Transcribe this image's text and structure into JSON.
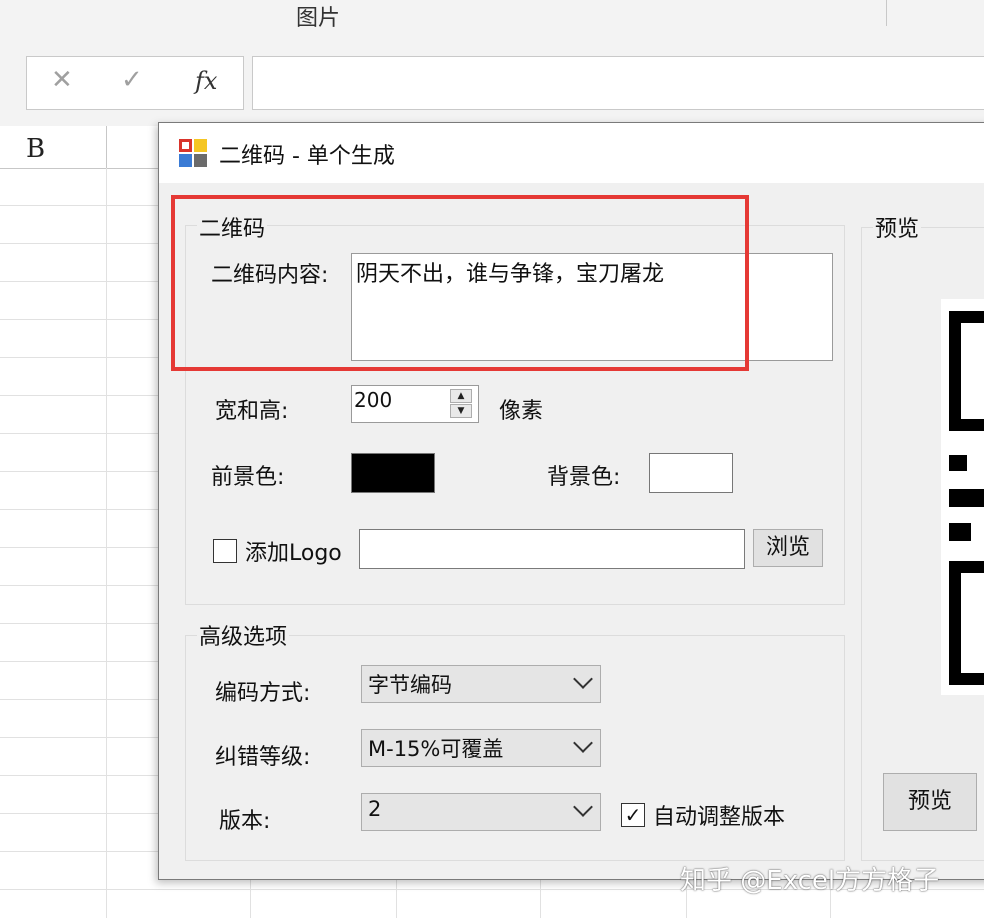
{
  "excel": {
    "ribbon_label": "图片",
    "formula_buttons": {
      "cancel": "✕",
      "enter": "✓",
      "fx": "fx"
    },
    "column_b": "B"
  },
  "dialog": {
    "title": "二维码 - 单个生成",
    "qr_group": {
      "legend": "二维码",
      "content_label": "二维码内容:",
      "content_value": "阴天不出，谁与争锋，宝刀屠龙",
      "size_label": "宽和高:",
      "size_value": "200",
      "size_unit": "像素",
      "fg_label": "前景色:",
      "bg_label": "背景色:",
      "fg_color": "#000000",
      "bg_color": "#ffffff",
      "add_logo_label": "添加Logo",
      "add_logo_checked": false,
      "browse_button": "浏览"
    },
    "advanced_group": {
      "legend": "高级选项",
      "encoding_label": "编码方式:",
      "encoding_value": "字节编码",
      "ecc_label": "纠错等级:",
      "ecc_value": "M-15%可覆盖",
      "version_label": "版本:",
      "version_value": "2",
      "auto_version_label": "自动调整版本",
      "auto_version_checked": true
    },
    "preview_group": {
      "legend": "预览",
      "preview_button": "预览"
    }
  },
  "watermark": "知乎 @Excel方方格子",
  "colors": {
    "highlight": "#e53935",
    "dialog_bg": "#f0f0f0"
  }
}
